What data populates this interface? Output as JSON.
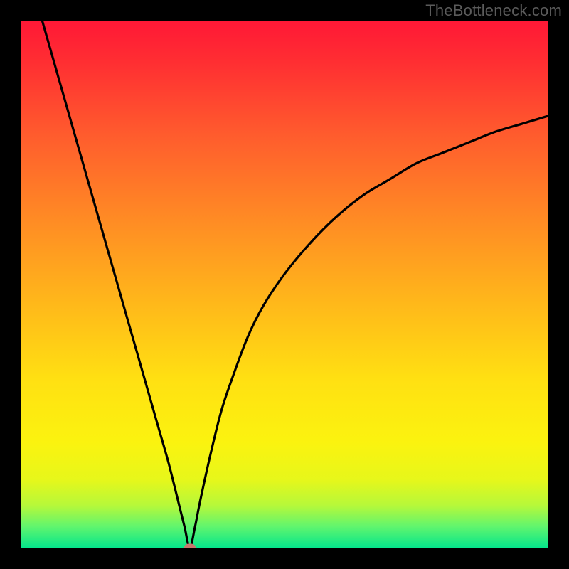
{
  "watermark": "TheBottleneck.com",
  "chart_data": {
    "type": "line",
    "title": "",
    "xlabel": "",
    "ylabel": "",
    "xlim": [
      0,
      100
    ],
    "ylim": [
      0,
      100
    ],
    "grid": false,
    "legend": false,
    "gradient_scale": {
      "description": "vertical background encoding bottleneck (top=red=high, bottom=green=low)",
      "stops": [
        {
          "pos": 0.0,
          "color": "#ff1836"
        },
        {
          "pos": 0.08,
          "color": "#ff2f32"
        },
        {
          "pos": 0.22,
          "color": "#ff5d2d"
        },
        {
          "pos": 0.38,
          "color": "#ff8c24"
        },
        {
          "pos": 0.54,
          "color": "#ffb91a"
        },
        {
          "pos": 0.68,
          "color": "#ffe012"
        },
        {
          "pos": 0.8,
          "color": "#fbf30f"
        },
        {
          "pos": 0.87,
          "color": "#e7f71a"
        },
        {
          "pos": 0.92,
          "color": "#b6f83a"
        },
        {
          "pos": 0.96,
          "color": "#60f56e"
        },
        {
          "pos": 1.0,
          "color": "#05e68b"
        }
      ]
    },
    "series": [
      {
        "name": "bottleneck-curve",
        "color": "#000000",
        "x": [
          4,
          6,
          8,
          10,
          12,
          14,
          16,
          18,
          20,
          22,
          24,
          26,
          28,
          30,
          31,
          32,
          33,
          34,
          36,
          38,
          40,
          43,
          46,
          50,
          55,
          60,
          65,
          70,
          75,
          80,
          85,
          90,
          95,
          100
        ],
        "y": [
          100,
          93,
          86,
          79,
          72,
          65,
          58,
          51,
          44,
          37,
          30,
          23,
          16,
          8,
          4,
          0,
          4,
          9,
          18,
          26,
          32,
          40,
          46,
          52,
          58,
          63,
          67,
          70,
          73,
          75,
          77,
          79,
          80.5,
          82
        ]
      }
    ],
    "minimum_marker": {
      "x": 32,
      "y": 0,
      "color": "#c8766e"
    }
  }
}
